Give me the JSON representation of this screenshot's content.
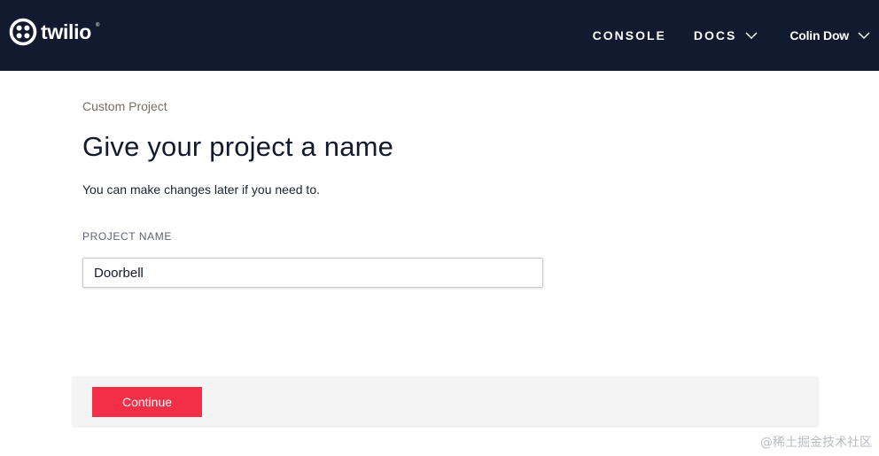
{
  "header": {
    "brand": "twilio",
    "trademark": "®",
    "nav": {
      "console": "CONSOLE",
      "docs": "DOCS",
      "user": "Colin Dow"
    }
  },
  "main": {
    "breadcrumb": "Custom Project",
    "title": "Give your project a name",
    "subtitle": "You can make changes later if you need to.",
    "field_label": "PROJECT NAME",
    "project_name_value": "Doorbell"
  },
  "footer": {
    "continue_label": "Continue"
  },
  "watermark": "@稀土掘金技术社区",
  "colors": {
    "header_bg": "#121a2f",
    "accent_red": "#f22f46",
    "footer_bg": "#f4f4f4"
  },
  "icons": [
    "twilio-logo-icon",
    "chevron-down-icon"
  ]
}
